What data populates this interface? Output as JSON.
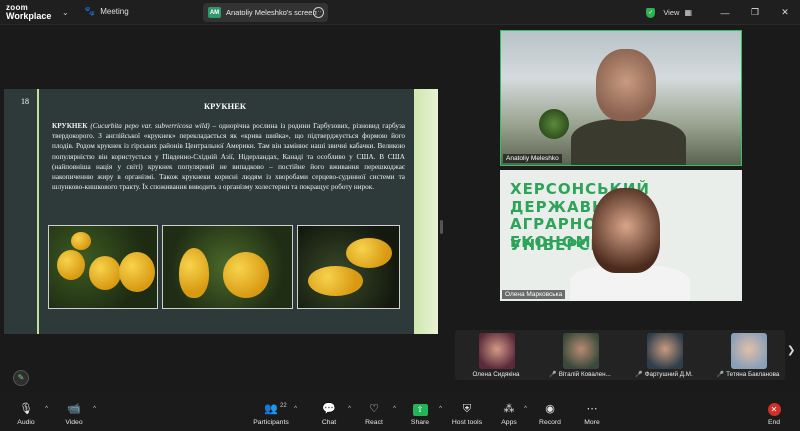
{
  "app": {
    "brand_line1": "zoom",
    "brand_line2": "Workplace"
  },
  "titlebar": {
    "meeting_label": "Meeting",
    "share_initials": "AM",
    "share_label": "Anatoliy Meleshko's screen",
    "view_label": "View"
  },
  "slide": {
    "number": "18",
    "title": "КРУКНЕК",
    "body_lead": "КРУКНЕК",
    "body_latin": "(Cucurbita pepo var. subverricosa wild)",
    "body_text": " – однорічна рослина із родини Гарбузових, різновид гарбуза твердокорого. З англійської «крукнек» перекладається як «крива шийка», що підтверджується формою його плодів. Родом крукнек із гірських районів Центральної Америки. Там він замінює наші звичні кабачки. Великою популярністю він користується у Південно-Східній Азії, Нідерландах, Канаді та особливо у США. В США (найповніша нація у світі) крукнек популярний не випадково – постійне його вживання перешкоджає накопиченню жиру в організмі. Також крукнеки корисні людям із хворобами серцево-судинної системи та шлунково-кишкового тракту. Їх споживання виводить з організму холестерин та покращує роботу нирок."
  },
  "videos": [
    {
      "name": "Anatoliy Meleshko"
    },
    {
      "name": "Олена Марковська",
      "banner_line1": "ХЕРСОНСЬКИЙ ДЕРЖАВНИЙ",
      "banner_line2": "АГРАРНО-ЕКОНОМІЧНИЙ",
      "banner_line3": "УНІВЕРСИТЕТ"
    }
  ],
  "thumbnails": [
    {
      "name": "Олена Сидякіна",
      "muted": false
    },
    {
      "name": "Віталій Ковален...",
      "muted": true
    },
    {
      "name": "Фартушний Д.М.",
      "muted": true
    },
    {
      "name": "Тетяна Бакланова",
      "muted": true
    }
  ],
  "toolbar": {
    "audio": "Audio",
    "video": "Video",
    "participants": "Participants",
    "participants_count": "22",
    "chat": "Chat",
    "react": "React",
    "share": "Share",
    "host_tools": "Host tools",
    "apps": "Apps",
    "record": "Record",
    "more": "More",
    "end": "End"
  },
  "colors": {
    "accent_green": "#25b35a",
    "end_red": "#d0302a",
    "speaker_border": "#29c36a"
  }
}
